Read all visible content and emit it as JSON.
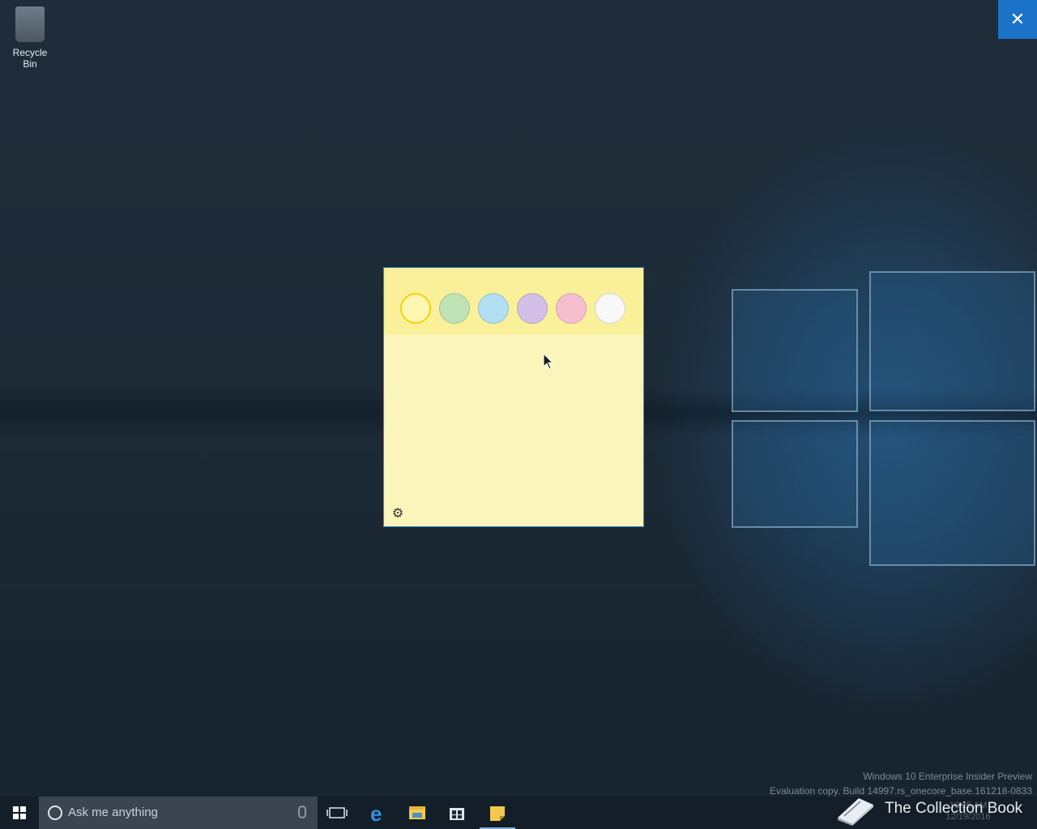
{
  "desktop": {
    "recycle_bin_label": "Recycle Bin",
    "close_glyph": "✕"
  },
  "sticky_note": {
    "color_swatches": [
      {
        "name": "Yellow",
        "color": "#fdf6b3",
        "selected": true
      },
      {
        "name": "Green",
        "color": "#bfe3b4"
      },
      {
        "name": "Blue",
        "color": "#b3dff2"
      },
      {
        "name": "Purple",
        "color": "#d4bfe8"
      },
      {
        "name": "Pink",
        "color": "#f6bfd0"
      },
      {
        "name": "White",
        "color": "#f8f8f8"
      }
    ],
    "settings_glyph": "⚙",
    "header_color": "#faf09a",
    "body_color": "#fbf5bc"
  },
  "watermark": {
    "line1": "Windows 10 Enterprise Insider Preview",
    "line2": "Evaluation copy. Build 14997.rs_onecore_base.161218-0833"
  },
  "taskbar": {
    "search_placeholder": "Ask me anything",
    "icons": [
      "windows-start-icon",
      "task-view-icon",
      "edge-icon",
      "file-explorer-icon",
      "store-icon",
      "sticky-notes-icon"
    ],
    "clock_time": "10:25 AM",
    "clock_date": "12/19/2016"
  },
  "brand": {
    "label": "The Collection Book"
  },
  "colors": {
    "accent": "#1a73c8",
    "note_border": "#3b8bd6"
  }
}
